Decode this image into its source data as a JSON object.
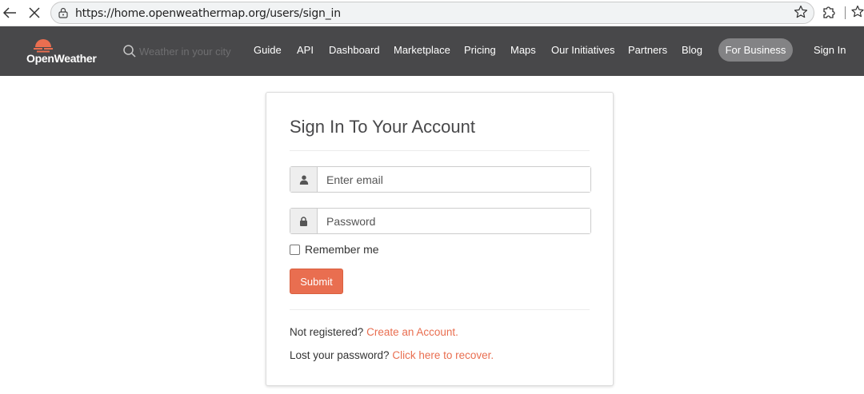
{
  "browser": {
    "url": "https://home.openweathermap.org/users/sign_in",
    "icons": {
      "back": "arrow-left-icon",
      "stop": "close-icon",
      "lock": "lock-icon",
      "star": "star-icon",
      "extensions": "puzzle-icon",
      "favorites": "favorites-icon"
    }
  },
  "header": {
    "logo_text": "OpenWeather",
    "search_placeholder": "Weather in your city",
    "nav": [
      {
        "label": "Guide"
      },
      {
        "label": "API"
      },
      {
        "label": "Dashboard"
      },
      {
        "label": "Marketplace"
      },
      {
        "label": "Pricing"
      },
      {
        "label": "Maps"
      },
      {
        "label": "Our Initiatives"
      },
      {
        "label": "Partners"
      },
      {
        "label": "Blog"
      }
    ],
    "for_business": "For Business",
    "sign_in": "Sign In",
    "colors": {
      "background": "#48484a",
      "accent": "#e96e50"
    }
  },
  "form": {
    "title": "Sign In To Your Account",
    "email_placeholder": "Enter email",
    "password_placeholder": "Password",
    "remember_label": "Remember me",
    "remember_checked": false,
    "submit_label": "Submit",
    "not_registered_text": "Not registered?",
    "create_account_link": "Create an Account.",
    "lost_password_text": "Lost your password?",
    "recover_link": "Click here to recover."
  }
}
